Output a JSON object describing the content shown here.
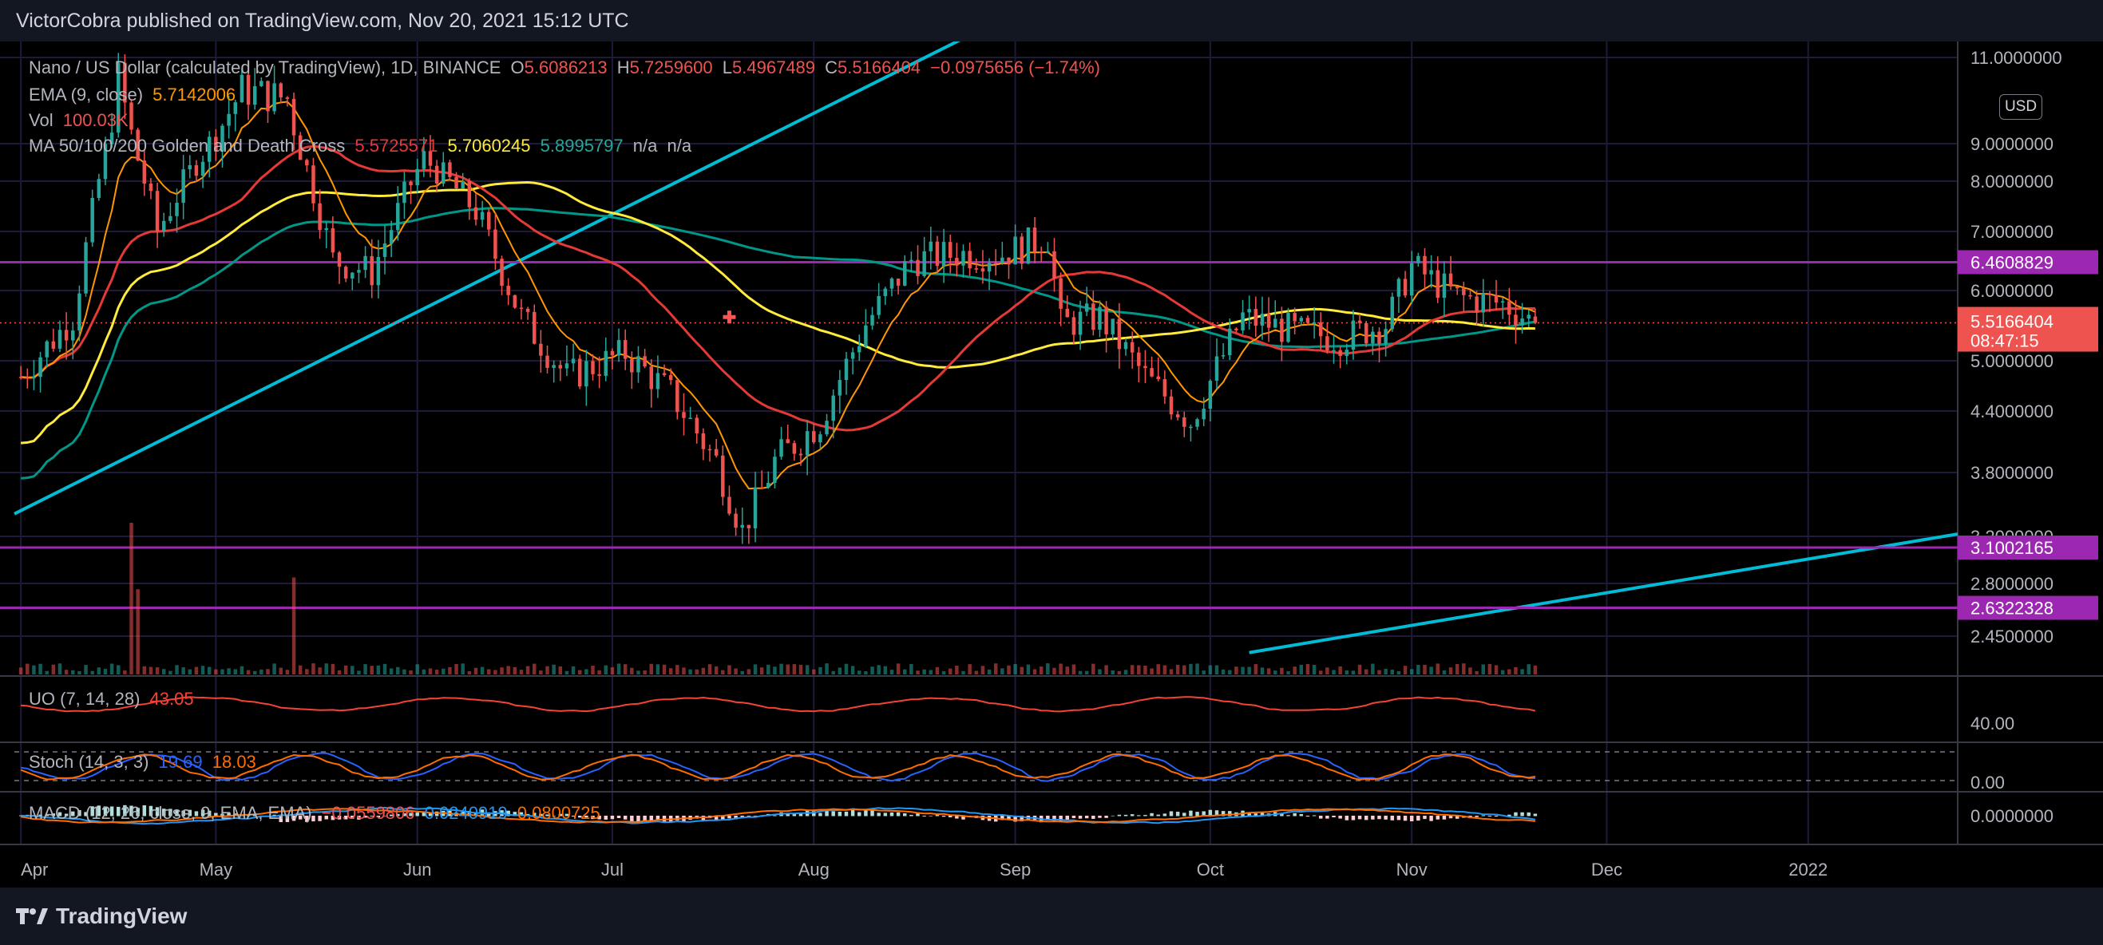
{
  "header": {
    "published": "VictorCobra published on TradingView.com, Nov 20, 2021 15:12 UTC"
  },
  "footer": {
    "brand": "TradingView"
  },
  "currency_badge": "USD",
  "legend": {
    "symbol": "Nano / US Dollar (calculated by TradingView), 1D, BINANCE",
    "o_label": "O",
    "o": "5.6086213",
    "h_label": "H",
    "h": "5.7259600",
    "l_label": "L",
    "l": "5.4967489",
    "c_label": "C",
    "c": "5.5166404",
    "change": "−0.0975656 (−1.74%)",
    "ema_label": "EMA (9, close)",
    "ema": "5.7142006",
    "vol_label": "Vol",
    "vol": "100.03K",
    "ma_label": "MA 50/100/200 Golden and Death Cross",
    "ma50": "5.5725571",
    "ma100": "5.7060245",
    "ma200": "5.8995797",
    "ma_na1": "n/a",
    "ma_na2": "n/a",
    "uo_label": "UO (7, 14, 28)",
    "uo": "43.05",
    "stoch_label": "Stoch (14, 3, 3)",
    "stoch_k": "19.69",
    "stoch_d": "18.03",
    "macd_label": "MACD (12, 26, close, 9, EMA, EMA)",
    "macd_hist": "−0.0559806",
    "macd": "0.0240919",
    "macd_signal": "0.0800725"
  },
  "colors": {
    "up": "#26a69a",
    "down": "#ef5350",
    "ema": "#ff9800",
    "ma50": "#e53935",
    "ma100": "#ffeb3b",
    "ma200": "#009688",
    "hline": "#9c27b0",
    "trend": "#00bcd4",
    "uo": "#f44336",
    "stoch_k": "#2962ff",
    "stoch_d": "#ff6d00",
    "macd": "#2196f3",
    "macd_signal": "#ff6d00"
  },
  "chart_data": {
    "type": "candlestick",
    "symbol": "NANOUSD",
    "x_ticks": [
      "Apr",
      "May",
      "Jun",
      "Jul",
      "Aug",
      "Sep",
      "Oct",
      "Nov",
      "Dec",
      "2022"
    ],
    "y_ticks": [
      "11.0000000",
      "9.0000000",
      "8.0000000",
      "7.0000000",
      "6.0000000",
      "5.0000000",
      "4.4000000",
      "3.8000000",
      "3.2000000",
      "2.8000000",
      "2.4500000"
    ],
    "y_scale": "log",
    "ylim": [
      2.35,
      11.2
    ],
    "x_range": [
      "2021-03-31",
      "2022-01-24"
    ],
    "last_date": "2021-11-20",
    "price_label": {
      "value": "5.5166404",
      "countdown": "08:47:15"
    },
    "horizontal_levels": [
      {
        "value": 6.4608829,
        "label": "6.4608829"
      },
      {
        "value": 3.1002165,
        "label": "3.1002165"
      },
      {
        "value": 2.6322328,
        "label": "2.6322328"
      }
    ],
    "trendlines": [
      {
        "from": [
          "2021-03-31",
          3.4
        ],
        "to": [
          "2021-08-24",
          11.5
        ]
      },
      {
        "from": [
          "2021-10-07",
          2.35
        ],
        "to": [
          "2022-01-24",
          3.22
        ]
      }
    ],
    "close_anchors": [
      [
        "2021-04-01",
        4.8
      ],
      [
        "2021-04-09",
        5.6
      ],
      [
        "2021-04-16",
        10.5
      ],
      [
        "2021-04-22",
        7.0
      ],
      [
        "2021-04-28",
        8.5
      ],
      [
        "2021-05-05",
        10.2
      ],
      [
        "2021-05-12",
        10.0
      ],
      [
        "2021-05-19",
        6.5
      ],
      [
        "2021-05-25",
        6.3
      ],
      [
        "2021-06-02",
        8.6
      ],
      [
        "2021-06-10",
        7.4
      ],
      [
        "2021-06-17",
        5.6
      ],
      [
        "2021-06-24",
        4.8
      ],
      [
        "2021-07-03",
        5.1
      ],
      [
        "2021-07-10",
        4.6
      ],
      [
        "2021-07-17",
        3.9
      ],
      [
        "2021-07-21",
        3.25
      ],
      [
        "2021-07-26",
        3.9
      ],
      [
        "2021-08-02",
        4.3
      ],
      [
        "2021-08-09",
        5.5
      ],
      [
        "2021-08-16",
        6.5
      ],
      [
        "2021-08-23",
        6.6
      ],
      [
        "2021-08-30",
        6.6
      ],
      [
        "2021-09-06",
        6.9
      ],
      [
        "2021-09-08",
        5.5
      ],
      [
        "2021-09-14",
        5.6
      ],
      [
        "2021-09-21",
        4.8
      ],
      [
        "2021-09-28",
        4.3
      ],
      [
        "2021-10-06",
        5.6
      ],
      [
        "2021-10-14",
        5.4
      ],
      [
        "2021-10-21",
        5.3
      ],
      [
        "2021-10-28",
        5.5
      ],
      [
        "2021-11-01",
        6.4
      ],
      [
        "2021-11-08",
        5.9
      ],
      [
        "2021-11-15",
        5.8
      ],
      [
        "2021-11-20",
        5.5166404
      ]
    ],
    "volume_spikes": [
      [
        "2021-04-18",
        1.0
      ],
      [
        "2021-04-19",
        0.55
      ],
      [
        "2021-05-13",
        0.63
      ]
    ],
    "uo_ticks": [
      "40.00"
    ],
    "stoch_ticks": [
      "0.00"
    ],
    "macd_ticks": [
      "0.0000000"
    ]
  }
}
